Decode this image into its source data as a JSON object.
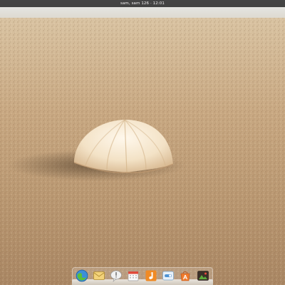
{
  "topbar": {
    "clock": "sam, sam 126 · 12:01"
  },
  "dock": {
    "items": [
      {
        "name": "browser-icon"
      },
      {
        "name": "mail-icon"
      },
      {
        "name": "chat-icon"
      },
      {
        "name": "calendar-icon"
      },
      {
        "name": "music-icon"
      },
      {
        "name": "settings-toggle-icon"
      },
      {
        "name": "software-center-icon"
      },
      {
        "name": "photos-icon"
      }
    ]
  },
  "colors": {
    "topbar": "#141414",
    "sand": "#c9ab84",
    "dock_shelf": "#e9e4dc"
  }
}
